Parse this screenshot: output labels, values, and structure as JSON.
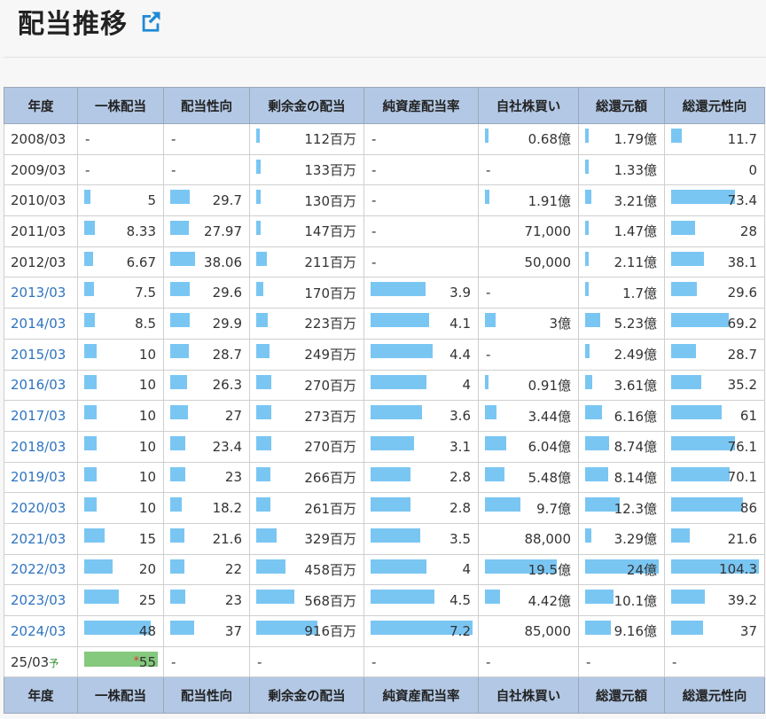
{
  "page": {
    "title": "配当推移"
  },
  "icons": {
    "external_link": "external-link-icon",
    "accent": "#1f8ad4"
  },
  "colors": {
    "bar": "#7ac6f3",
    "estimate_bar": "#84c97d",
    "header_bg": "#b3c8e4",
    "link": "#2f74c0"
  },
  "table": {
    "columns": [
      "年度",
      "一株配当",
      "配当性向",
      "剰余金の配当",
      "純資産配当率",
      "自社株買い",
      "総還元額",
      "総還元性向"
    ],
    "rows": [
      {
        "year": "2008/03",
        "link": false,
        "c": [
          "-",
          "-",
          "112百万",
          "-",
          "0.68億",
          "1.79億",
          "11.7"
        ],
        "b": [
          null,
          null,
          0.03,
          null,
          0.02,
          0.03,
          0.12
        ]
      },
      {
        "year": "2009/03",
        "link": false,
        "c": [
          "-",
          "-",
          "133百万",
          "-",
          "-",
          "1.33億",
          "0"
        ],
        "b": [
          null,
          null,
          0.04,
          null,
          null,
          0.03,
          null
        ]
      },
      {
        "year": "2010/03",
        "link": false,
        "c": [
          "5",
          "29.7",
          "130百万",
          "-",
          "1.91億",
          "3.21億",
          "73.4"
        ],
        "b": [
          0.08,
          0.26,
          0.04,
          null,
          0.05,
          0.09,
          0.73
        ]
      },
      {
        "year": "2011/03",
        "link": false,
        "c": [
          "8.33",
          "27.97",
          "147百万",
          "-",
          "71,000",
          "1.47億",
          "28"
        ],
        "b": [
          0.15,
          0.25,
          0.04,
          null,
          null,
          0.03,
          0.27
        ]
      },
      {
        "year": "2012/03",
        "link": false,
        "c": [
          "6.67",
          "38.06",
          "211百万",
          "-",
          "50,000",
          "2.11億",
          "38.1"
        ],
        "b": [
          0.12,
          0.34,
          0.1,
          null,
          null,
          0.05,
          0.37
        ]
      },
      {
        "year": "2013/03",
        "link": true,
        "c": [
          "7.5",
          "29.6",
          "170百万",
          "3.9",
          "-",
          "1.7億",
          "29.6"
        ],
        "b": [
          0.13,
          0.26,
          0.07,
          0.54,
          null,
          0.04,
          0.29
        ]
      },
      {
        "year": "2014/03",
        "link": true,
        "c": [
          "8.5",
          "29.9",
          "223百万",
          "4.1",
          "3億",
          "5.23億",
          "69.2"
        ],
        "b": [
          0.15,
          0.26,
          0.11,
          0.57,
          0.12,
          0.2,
          0.66
        ]
      },
      {
        "year": "2015/03",
        "link": true,
        "c": [
          "10",
          "28.7",
          "249百万",
          "4.4",
          "-",
          "2.49億",
          "28.7"
        ],
        "b": [
          0.17,
          0.25,
          0.13,
          0.61,
          null,
          0.06,
          0.28
        ]
      },
      {
        "year": "2016/03",
        "link": true,
        "c": [
          "10",
          "26.3",
          "270百万",
          "4",
          "0.91億",
          "3.61億",
          "35.2"
        ],
        "b": [
          0.17,
          0.23,
          0.15,
          0.55,
          0.03,
          0.1,
          0.34
        ]
      },
      {
        "year": "2017/03",
        "link": true,
        "c": [
          "10",
          "27",
          "273百万",
          "3.6",
          "3.44億",
          "6.16億",
          "61"
        ],
        "b": [
          0.17,
          0.24,
          0.15,
          0.5,
          0.13,
          0.23,
          0.58
        ]
      },
      {
        "year": "2018/03",
        "link": true,
        "c": [
          "10",
          "23.4",
          "270百万",
          "3.1",
          "6.04億",
          "8.74億",
          "76.1"
        ],
        "b": [
          0.17,
          0.2,
          0.15,
          0.43,
          0.24,
          0.33,
          0.73
        ]
      },
      {
        "year": "2019/03",
        "link": true,
        "c": [
          "10",
          "23",
          "266百万",
          "2.8",
          "5.48億",
          "8.14億",
          "70.1"
        ],
        "b": [
          0.17,
          0.2,
          0.14,
          0.39,
          0.22,
          0.31,
          0.67
        ]
      },
      {
        "year": "2020/03",
        "link": true,
        "c": [
          "10",
          "18.2",
          "261百万",
          "2.8",
          "9.7億",
          "12.3億",
          "86"
        ],
        "b": [
          0.17,
          0.16,
          0.14,
          0.39,
          0.4,
          0.47,
          0.82
        ]
      },
      {
        "year": "2021/03",
        "link": true,
        "c": [
          "15",
          "21.6",
          "329百万",
          "3.5",
          "88,000",
          "3.29億",
          "21.6"
        ],
        "b": [
          0.28,
          0.19,
          0.2,
          0.49,
          null,
          0.09,
          0.21
        ]
      },
      {
        "year": "2022/03",
        "link": true,
        "c": [
          "20",
          "22",
          "458百万",
          "4",
          "19.5億",
          "24億",
          "104.3"
        ],
        "b": [
          0.38,
          0.19,
          0.29,
          0.55,
          0.82,
          1.0,
          1.0
        ]
      },
      {
        "year": "2023/03",
        "link": true,
        "c": [
          "25",
          "23",
          "568百万",
          "4.5",
          "4.42億",
          "10.1億",
          "39.2"
        ],
        "b": [
          0.47,
          0.2,
          0.37,
          0.63,
          0.17,
          0.39,
          0.38
        ]
      },
      {
        "year": "2024/03",
        "link": true,
        "c": [
          "48",
          "37",
          "916百万",
          "7.2",
          "85,000",
          "9.16億",
          "37"
        ],
        "b": [
          0.9,
          0.33,
          0.6,
          1.0,
          null,
          0.35,
          0.36
        ]
      }
    ],
    "plan_row": {
      "year": "25/03",
      "yo": "予",
      "mark": "*",
      "value": "55",
      "bar": 1.0,
      "rest": [
        "-",
        "-",
        "-",
        "-",
        "-",
        "-"
      ]
    }
  }
}
